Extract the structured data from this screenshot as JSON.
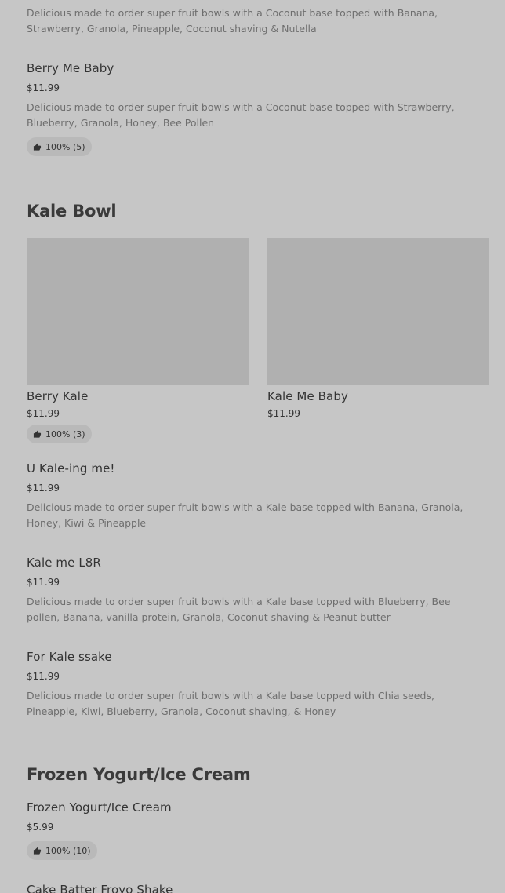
{
  "items": {
    "nutella": {
      "desc": "Delicious made to order super fruit bowls with a Coconut base topped with Banana, Strawberry, Granola, Pineapple, Coconut shaving & Nutella"
    },
    "berry_me_baby": {
      "title": "Berry Me Baby",
      "price": "$11.99",
      "desc": "Delicious made to order super fruit bowls with a Coconut base topped with Strawberry, Blueberry, Granola, Honey, Bee Pollen",
      "rating": "100% (5)"
    },
    "berry_kale": {
      "title": "Berry Kale",
      "price": "$11.99",
      "rating": "100% (3)"
    },
    "kale_me_baby": {
      "title": "Kale Me Baby",
      "price": "$11.99"
    },
    "u_kale_ing": {
      "title": "U Kale-ing me!",
      "price": "$11.99",
      "desc": "Delicious made to order super fruit bowls with a Kale base topped with Banana, Granola, Honey, Kiwi & Pineapple"
    },
    "kale_me_l8r": {
      "title": "Kale me L8R",
      "price": "$11.99",
      "desc": "Delicious made to order super fruit bowls with a Kale base topped with Blueberry, Bee pollen, Banana, vanilla protein, Granola, Coconut shaving & Peanut butter"
    },
    "for_kale_ssake": {
      "title": "For Kale ssake",
      "price": "$11.99",
      "desc": "Delicious made to order super fruit bowls with a Kale base topped with Chia seeds, Pineapple, Kiwi, Blueberry, Granola, Coconut shaving, & Honey"
    },
    "frozen_yogurt": {
      "title": "Frozen Yogurt/Ice Cream",
      "price": "$5.99",
      "rating": "100% (10)"
    },
    "cake_batter": {
      "title": "Cake Batter Froyo Shake"
    }
  },
  "sections": {
    "kale_bowl": "Kale Bowl",
    "frozen_yogurt": "Frozen Yogurt/Ice Cream"
  },
  "icons": {
    "rating": "thumbs-up-icon"
  },
  "colors": {
    "background": "#c6c6c6",
    "image_placeholder": "#b0b0b0",
    "badge": "#b9b9b9"
  }
}
